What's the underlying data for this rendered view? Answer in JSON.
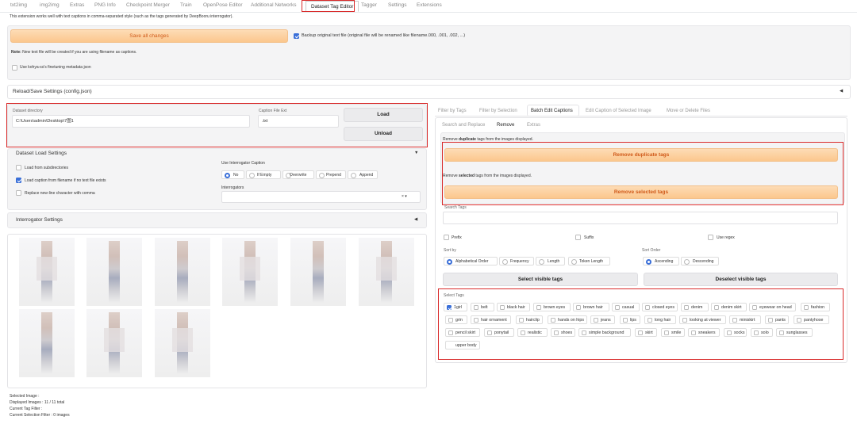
{
  "tabs": [
    "txt2img",
    "img2img",
    "Extras",
    "PNG Info",
    "Checkpoint Merger",
    "Train",
    "OpenPose Editor",
    "Additional Networks",
    "Dataset Tag Editor",
    "Tagger",
    "Settings",
    "Extensions"
  ],
  "intro": "This extension works well with text captions in comma-separated style (such as the tags generated by DeepBooru interrogator).",
  "save_all": "Save all changes",
  "backup_label": "Backup original text file (original file will be renamed like filename.000, .001, .002, ...)",
  "note": "Note:",
  "note_text": "New text file will be created if you are using filename as captions.",
  "kohya_label": "Use kohya-ss's finetuning metadata json",
  "reload_save": "Reload/Save Settings (config.json)",
  "dataset_dir_label": "Dataset directory",
  "dataset_dir_value": "C:\\Users\\admin\\Desktop\\7图1",
  "caption_ext_label": "Caption File Ext",
  "caption_ext_value": ".txt",
  "load_btn": "Load",
  "unload_btn": "Unload",
  "dataset_load_settings": "Dataset Load Settings",
  "load_subdirs": "Load from subdirectories",
  "load_caption_filename": "Load caption from filename if no text file exists",
  "replace_newline": "Replace new-line character with comma",
  "use_interrogator_caption": "Use Interrogator Caption",
  "interrogator_opts": [
    "No",
    "If Empty",
    "Overwrite",
    "Prepend",
    "Append"
  ],
  "interrogators_label": "Interrogators",
  "interrogators_clear": "× ▾",
  "interrogator_settings": "Interrogator Settings",
  "collapse_down": "▼",
  "collapse_left": "◀",
  "status": {
    "selected_image": "Selected Image :",
    "displayed_images": "Displayed Images : 11 / 11 total",
    "current_tag_filter": "Current Tag Filter :",
    "current_selection_filter": "Current Selection Filter : 0 images"
  },
  "right_tabs": [
    "Filter by Tags",
    "Filter by Selection",
    "Batch Edit Captions",
    "Edit Caption of Selected Image",
    "Move or Delete Files"
  ],
  "sub_tabs": [
    "Search and Replace",
    "Remove",
    "Extras"
  ],
  "remove_dup_text_a": "Remove ",
  "remove_dup_text_b": "duplicate",
  "remove_dup_text_c": " tags from the images displayed.",
  "remove_dup_btn": "Remove duplicate tags",
  "remove_sel_text_a": "Remove ",
  "remove_sel_text_b": "selected",
  "remove_sel_text_c": " tags from the images displayed.",
  "remove_sel_btn": "Remove selected tags",
  "search_tags_label": "Search Tags",
  "prefix": "Prefix",
  "suffix": "Suffix",
  "use_regex": "Use regex",
  "sort_by_label": "Sort by",
  "sort_by_opts": [
    "Alphabetical Order",
    "Frequency",
    "Length",
    "Token Length"
  ],
  "sort_order_label": "Sort Order",
  "sort_order_opts": [
    "Ascending",
    "Descending"
  ],
  "select_visible": "Select visible tags",
  "deselect_visible": "Deselect visible tags",
  "select_tags_label": "Select Tags",
  "tags": [
    "1girl",
    "belt",
    "black hair",
    "brown eyes",
    "brown hair",
    "casual",
    "closed eyes",
    "denim",
    "denim skirt",
    "eyewear on head",
    "fashion",
    "grin",
    "hair ornament",
    "hairclip",
    "hands on hips",
    "jeans",
    "lips",
    "long hair",
    "looking at viewer",
    "miniskirt",
    "pants",
    "pantyhose",
    "pencil skirt",
    "ponytail",
    "realistic",
    "shoes",
    "simple background",
    "skirt",
    "smile",
    "sneakers",
    "socks",
    "solo",
    "sunglasses",
    "upper body"
  ],
  "colors": {
    "accent": "#3a6fd8",
    "highlight": "#d92b2b",
    "orange_text": "#d05a1a"
  }
}
